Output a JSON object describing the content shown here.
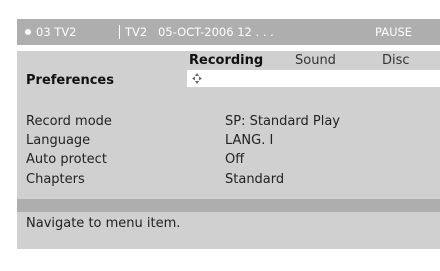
{
  "topbar": {
    "channel_number": "03 TV2",
    "channel_name": "TV2",
    "datetime": "05-OCT-2006 12 . . .",
    "state": "PAUSE"
  },
  "tabs": [
    {
      "label": "Recording",
      "active": true
    },
    {
      "label": "Sound",
      "active": false
    },
    {
      "label": "Disc",
      "active": false
    }
  ],
  "section_title": "Preferences",
  "settings": [
    {
      "label": "Record mode",
      "value": "SP: Standard Play"
    },
    {
      "label": "Language",
      "value": "LANG. I"
    },
    {
      "label": "Auto protect",
      "value": "Off"
    },
    {
      "label": "Chapters",
      "value": "Standard"
    }
  ],
  "status_message": "Navigate to menu item.",
  "colors": {
    "panel": "#d0d0d0",
    "bar": "#aeaeae",
    "highlight": "#ffffff"
  },
  "icons": {
    "nav": "four-way-arrows-icon",
    "live_indicator": "dot-icon"
  }
}
